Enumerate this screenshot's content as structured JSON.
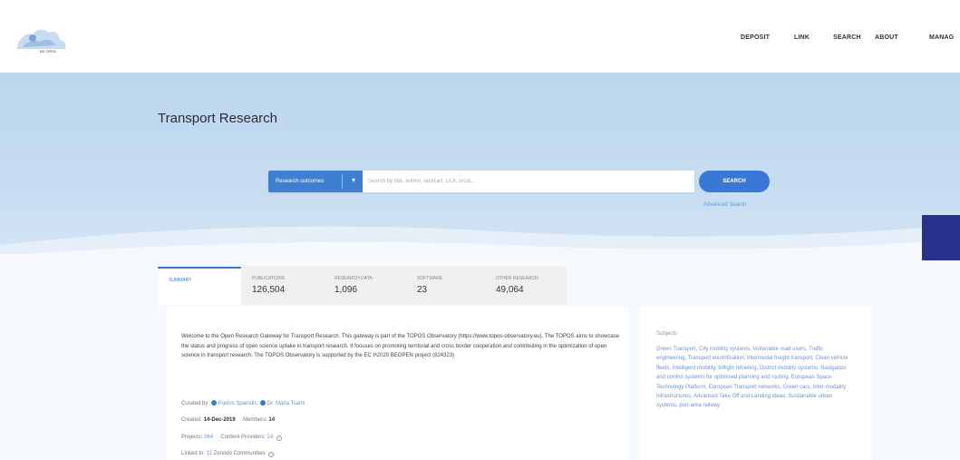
{
  "nav": {
    "deposit": "DEPOSIT",
    "link": "LINK",
    "search": "SEARCH",
    "about": "ABOUT",
    "manage": "MANAG"
  },
  "logo": {
    "text": "BE OPEN",
    "icon": "beopen-logo-icon"
  },
  "hero": {
    "title": "Transport Research",
    "search": {
      "type_selected": "Research outcomes",
      "placeholder": "Search by title, author, abstract, DOI, orcid...",
      "button": "SEARCH",
      "advanced": "Advanced Search"
    }
  },
  "tabs": [
    {
      "label": "SUMMARY",
      "count": ""
    },
    {
      "label": "PUBLICATIONS",
      "count": "126,504"
    },
    {
      "label": "RESEARCH DATA",
      "count": "1,096"
    },
    {
      "label": "SOFTWARE",
      "count": "23"
    },
    {
      "label": "OTHER RESEARCH",
      "count": "49,064"
    }
  ],
  "summary": {
    "text": "Welcome to the Open Research Gateway for Transport Research. This gateway is part of the TOPOS Observatory (https://www.topos-observatory.eu). The TOPOS aims to showcase the status and progress of open science uptake in transport research. It focuses on promoting territorial and cross border cooperation and contributing in the optimization of open science in transport research. The TOPOS Observatory is supported by the EC H2020 BEOPEN project (824323)",
    "curated_label": "Curated by:",
    "curators": [
      "Pavlos Spanidis",
      "Dr. Maria Tsami"
    ],
    "created_label": "Created:",
    "created_value": "14-Dec-2019",
    "members_label": "Members:",
    "members_value": "14",
    "projects_label": "Projects:",
    "projects_value": "364",
    "providers_label": "Content Providers:",
    "providers_value": "24",
    "linked_label": "Linked to:",
    "linked_value": "11",
    "linked_suffix": "Zenodo Communities"
  },
  "subjects": {
    "title": "Subjects",
    "text": "Green Transport, City mobility systems, Vulnerable road users, Traffic engineering, Transport electrification, Intermodal freight transport, Clean vehicle fleets, Intelligent mobility, Inflight refueling, District mobility systems, Navigation and control systems for optimised planning and routing, European Space Technology Platform, European Transport networks, Green cars, Inter-modality infrastructures, Advanced Take Off and Landing ideas, Sustainable urban systems, port-area railway"
  },
  "colors": {
    "accent": "#3a78d6",
    "hero_bg": "#c6dcf1",
    "side_tab": "#27308c"
  }
}
